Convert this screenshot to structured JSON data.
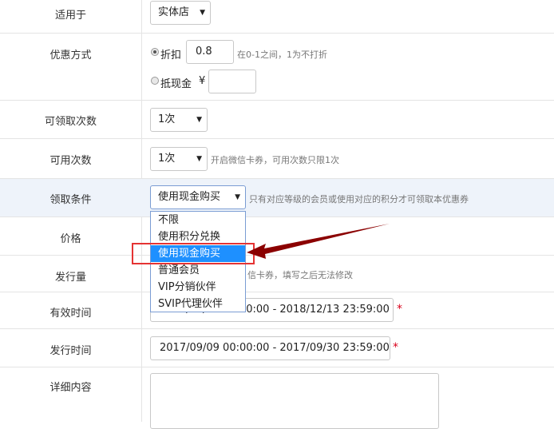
{
  "rows": {
    "applies_to": {
      "label": "适用于",
      "value": "实体店"
    },
    "discount_method": {
      "label": "优惠方式",
      "option_discount": "折扣",
      "discount_value": "0.8",
      "discount_hint": "在0-1之间，1为不打折",
      "option_cash": "抵现金",
      "currency": "¥",
      "cash_value": ""
    },
    "claim_times": {
      "label": "可领取次数",
      "value": "1次"
    },
    "usable_times": {
      "label": "可用次数",
      "value": "1次",
      "hint": "开启微信卡券，可用次数只限1次"
    },
    "claim_condition": {
      "label": "领取条件",
      "value": "使用现金购买",
      "hint": "只有对应等级的会员或使用对应的积分才可领取本优惠券",
      "options": [
        "不限",
        "使用积分兑换",
        "使用现金购买",
        "普通会员",
        "VIP分销伙伴",
        "SVIP代理伙伴"
      ],
      "selected_index": 2
    },
    "price": {
      "label": "价格"
    },
    "issue_amount": {
      "label": "发行量",
      "hint": "信卡券，填写之后无法修改"
    },
    "valid_time": {
      "label": "有效时间",
      "value": "2017/09/09 00:00:00 - 2018/12/13 23:59:00",
      "required_mark": "*"
    },
    "issue_time": {
      "label": "发行时间",
      "value": "2017/09/09 00:00:00 - 2017/09/30 23:59:00",
      "required_mark": "*"
    },
    "details": {
      "label": "详细内容",
      "value": ""
    }
  },
  "colors": {
    "highlight_row": "#eef3fa",
    "dropdown_active": "#1e90ff",
    "annotation_red": "#e53333",
    "arrow": "#8b0000"
  }
}
